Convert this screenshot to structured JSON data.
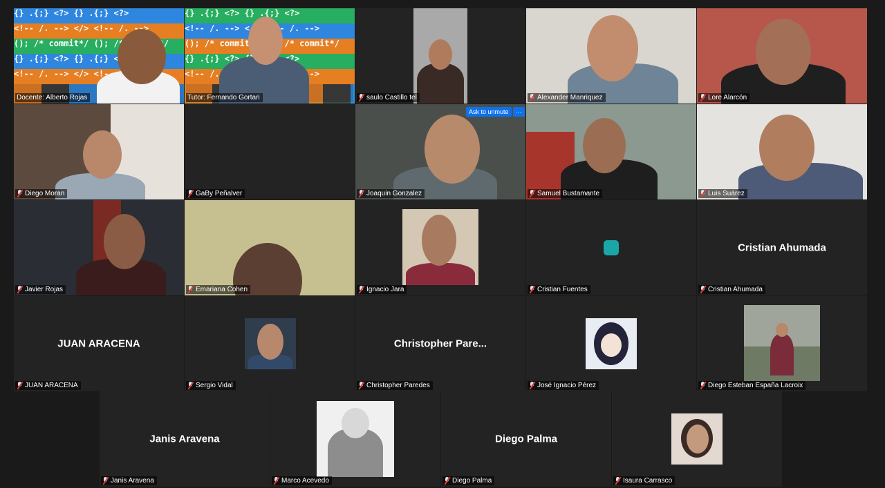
{
  "participants": [
    {
      "name": "Docente: Alberto Rojas",
      "muted": false
    },
    {
      "name": "Tutor: Fernando Gortari",
      "muted": false,
      "speaking": true
    },
    {
      "name": "saulo Castillo tel",
      "muted": true
    },
    {
      "name": "Alexander Manriquez",
      "muted": true
    },
    {
      "name": "Lore Alarcón",
      "muted": true
    },
    {
      "name": "Diego Moran",
      "muted": true
    },
    {
      "name": "GaBy Peñalver",
      "muted": true
    },
    {
      "name": "Joaquin Gonzalez",
      "muted": true
    },
    {
      "name": "Samuel Bustamante",
      "muted": true
    },
    {
      "name": "Luis Suárez",
      "muted": true
    },
    {
      "name": "Javier Rojas",
      "muted": true
    },
    {
      "name": "Emariana Cohen",
      "muted": true
    },
    {
      "name": "Ignacio Jara",
      "muted": true
    },
    {
      "name": "Cristian Fuentes",
      "muted": true
    },
    {
      "name": "Cristian Ahumada",
      "muted": true,
      "display_name": "Cristian Ahumada"
    },
    {
      "name": "JUAN ARACENA",
      "muted": true,
      "display_name": "JUAN ARACENA"
    },
    {
      "name": "Sergio Vidal",
      "muted": true
    },
    {
      "name": "Christopher Paredes",
      "muted": true,
      "display_name": "Christopher  Pare..."
    },
    {
      "name": "José Ignacio Pérez",
      "muted": true
    },
    {
      "name": "Diego Esteban España Lacroix",
      "muted": true
    },
    {
      "name": "Janis Aravena",
      "muted": true,
      "display_name": "Janis Aravena"
    },
    {
      "name": "Marco Acevedo",
      "muted": true
    },
    {
      "name": "Diego Palma",
      "muted": true,
      "display_name": "Diego Palma"
    },
    {
      "name": "Isaura Carrasco",
      "muted": true
    }
  ],
  "controls": {
    "ask_to_unmute": "Ask to unmute",
    "more": "···"
  },
  "code_rows": [
    "{} .{;} <?> {} .{;} <?>",
    "<!-- /. --> </> <!-- /. -->",
    "(); /* commit*/ (); /* commit*/",
    "{} .{;} <?> {} .{;} <?>",
    "<!-- /. --> </> <!-- /. -->"
  ],
  "colors": {
    "speaking_border": "#2dd4a8",
    "muted_icon": "#e23b3b",
    "button": "#0e71eb",
    "teal_avatar": "#1aa6a6"
  }
}
